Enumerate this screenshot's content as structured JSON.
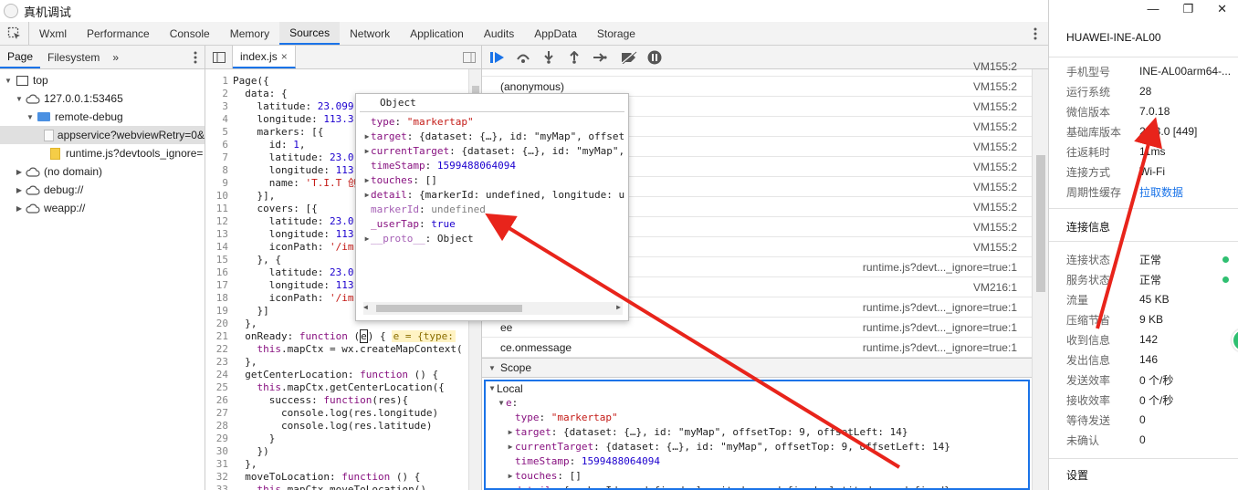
{
  "window": {
    "title": "真机调试"
  },
  "main_tabs": [
    "Wxml",
    "Performance",
    "Console",
    "Memory",
    "Sources",
    "Network",
    "Application",
    "Audits",
    "AppData",
    "Storage"
  ],
  "main_tab_active": "Sources",
  "nav": {
    "tabs": [
      "Page",
      "Filesystem"
    ],
    "more": "»",
    "tree": [
      {
        "label": "top",
        "level": 0,
        "icon": "frame-icon",
        "expanded": true
      },
      {
        "label": "127.0.0.1:53465",
        "level": 1,
        "icon": "cloud-icon",
        "expanded": true
      },
      {
        "label": "remote-debug",
        "level": 2,
        "icon": "folder-icon",
        "expanded": true
      },
      {
        "label": "appservice?webviewRetry=0&",
        "level": 3,
        "icon": "file-icon",
        "selected": true
      },
      {
        "label": "runtime.js?devtools_ignore=",
        "level": 3,
        "icon": "js-file-icon"
      },
      {
        "label": "(no domain)",
        "level": 1,
        "icon": "cloud-icon",
        "collapsed": true
      },
      {
        "label": "debug://",
        "level": 1,
        "icon": "cloud-icon",
        "collapsed": true
      },
      {
        "label": "weapp://",
        "level": 1,
        "icon": "cloud-icon",
        "collapsed": true
      }
    ]
  },
  "editor": {
    "file_tab": "index.js",
    "close": "×",
    "lines": [
      "Page({",
      "  data: {",
      "    latitude: 23.099",
      "    longitude: 113.3",
      "    markers: [{",
      "      id: 1,",
      "      latitude: 23.0",
      "      longitude: 113",
      "      name: 'T.I.T 创",
      "    }],",
      "    covers: [{",
      "      latitude: 23.0",
      "      longitude: 113",
      "      iconPath: '/im",
      "    }, {",
      "      latitude: 23.0",
      "      longitude: 113",
      "      iconPath: '/im",
      "    }]",
      "  },",
      "  onReady: function (e) {",
      "    this.mapCtx = wx.createMapContext(",
      "  },",
      "  getCenterLocation: function () {",
      "    this.mapCtx.getCenterLocation({",
      "      success: function(res){",
      "        console.log(res.longitude)",
      "        console.log(res.latitude)",
      "      }",
      "    })",
      "  },",
      "  moveToLocation: function () {",
      "    this.mapCtx.moveToLocation()"
    ],
    "inline_value": "e = {type:"
  },
  "popover": {
    "title": "Object",
    "rows": [
      {
        "key": "type",
        "value": "\"markertap\"",
        "kind": "str",
        "expandable": false
      },
      {
        "key": "target",
        "value": "{dataset: {…}, id: \"myMap\", offset",
        "kind": "obj",
        "expandable": true
      },
      {
        "key": "currentTarget",
        "value": "{dataset: {…}, id: \"myMap\",",
        "kind": "obj",
        "expandable": true
      },
      {
        "key": "timeStamp",
        "value": "1599488064094",
        "kind": "num",
        "expandable": false
      },
      {
        "key": "touches",
        "value": "[]",
        "kind": "obj",
        "expandable": true
      },
      {
        "key": "detail",
        "value": "{markerId: undefined, longitude: u",
        "kind": "obj",
        "expandable": true
      },
      {
        "key": "markerId",
        "value": "undefined",
        "kind": "undef",
        "expandable": false
      },
      {
        "key": "_userTap",
        "value": "true",
        "kind": "num",
        "expandable": false
      },
      {
        "key": "__proto__",
        "value": "Object",
        "kind": "obj",
        "expandable": true
      }
    ]
  },
  "callstack": [
    {
      "name": "",
      "loc": "VM155:2"
    },
    {
      "name": "(anonymous)",
      "loc": "VM155:2"
    },
    {
      "name": "",
      "loc": "VM155:2"
    },
    {
      "name": "",
      "loc": "VM155:2"
    },
    {
      "name": "",
      "loc": "VM155:2"
    },
    {
      "name": "",
      "loc": "VM155:2"
    },
    {
      "name": "",
      "loc": "VM155:2"
    },
    {
      "name": "",
      "loc": "VM155:2"
    },
    {
      "name": "",
      "loc": "VM155:2"
    },
    {
      "name": "",
      "loc": "VM155:2"
    },
    {
      "name": "",
      "loc": "runtime.js?devt..._ignore=true:1"
    },
    {
      "name": "",
      "loc": "VM216:1"
    },
    {
      "name": "",
      "loc": "runtime.js?devt..._ignore=true:1"
    },
    {
      "name": "ee",
      "loc": "runtime.js?devt..._ignore=true:1"
    },
    {
      "name": "ce.onmessage",
      "loc": "runtime.js?devt..._ignore=true:1"
    }
  ],
  "scope": {
    "header": "Scope",
    "local_label": "Local",
    "var_name": "e",
    "rows": [
      {
        "indent": 2,
        "key": "type",
        "value": "\"markertap\"",
        "kind": "str",
        "expandable": false
      },
      {
        "indent": 2,
        "key": "target",
        "value": "{dataset: {…}, id: \"myMap\", offsetTop: 9, offsetLeft: 14}",
        "kind": "obj",
        "expandable": true
      },
      {
        "indent": 2,
        "key": "currentTarget",
        "value": "{dataset: {…}, id: \"myMap\", offsetTop: 9, offsetLeft: 14}",
        "kind": "obj",
        "expandable": true
      },
      {
        "indent": 2,
        "key": "timeStamp",
        "value": "1599488064094",
        "kind": "num",
        "expandable": false
      },
      {
        "indent": 2,
        "key": "touches",
        "value": "[]",
        "kind": "obj",
        "expandable": true
      },
      {
        "indent": 2,
        "key": "detail",
        "value": "{markerId: undefined, longitude: undefined, latitude: undefined}",
        "kind": "obj",
        "expandable": true
      }
    ]
  },
  "device": {
    "name": "HUAWEI-INE-AL00",
    "window_controls": {
      "minimize": "—",
      "maximize": "❐",
      "close": "✕"
    },
    "info": [
      {
        "k": "手机型号",
        "v": "INE-AL00arm64-..."
      },
      {
        "k": "运行系统",
        "v": "28"
      },
      {
        "k": "微信版本",
        "v": "7.0.18"
      },
      {
        "k": "基础库版本",
        "v": "2.13.0 [449]"
      },
      {
        "k": "往返耗时",
        "v": "11ms"
      },
      {
        "k": "连接方式",
        "v": "Wi-Fi"
      },
      {
        "k": "周期性缓存",
        "v": "拉取数据",
        "link": true
      }
    ],
    "conn_title": "连接信息",
    "conn": [
      {
        "k": "连接状态",
        "v": "正常",
        "dot": true
      },
      {
        "k": "服务状态",
        "v": "正常",
        "dot": true
      },
      {
        "k": "流量",
        "v": "45 KB"
      },
      {
        "k": "压缩节省",
        "v": "9 KB"
      },
      {
        "k": "收到信息",
        "v": "142"
      },
      {
        "k": "发出信息",
        "v": "146"
      },
      {
        "k": "发送效率",
        "v": "0 个/秒"
      },
      {
        "k": "接收效率",
        "v": "0 个/秒"
      },
      {
        "k": "等待发送",
        "v": "0"
      },
      {
        "k": "未确认",
        "v": "0"
      }
    ],
    "settings": "设置"
  },
  "colors": {
    "accent": "#1a73e8",
    "annotation": "#e8241b",
    "status_ok": "#2fbf71"
  }
}
